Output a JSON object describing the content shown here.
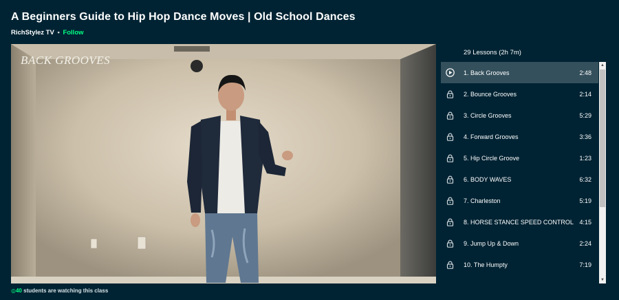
{
  "class": {
    "title": "A Beginners Guide to Hip Hop Dance Moves | Old School Dances",
    "teacher": "RichStylez TV",
    "separator": "•",
    "follow_label": "Follow"
  },
  "video": {
    "caption": "BACK GROOVES"
  },
  "watching": {
    "count": "40",
    "text": "students are watching this class"
  },
  "lessons": {
    "summary": "29 Lessons (2h 7m)",
    "items": [
      {
        "label": "1. Back Grooves",
        "duration": "2:48",
        "status": "playing"
      },
      {
        "label": "2. Bounce Grooves",
        "duration": "2:14",
        "status": "locked"
      },
      {
        "label": "3. Circle Grooves",
        "duration": "5:29",
        "status": "locked"
      },
      {
        "label": "4. Forward Grooves",
        "duration": "3:36",
        "status": "locked"
      },
      {
        "label": "5. Hip Circle Groove",
        "duration": "1:23",
        "status": "locked"
      },
      {
        "label": "6. BODY WAVES",
        "duration": "6:32",
        "status": "locked"
      },
      {
        "label": "7. Charleston",
        "duration": "5:19",
        "status": "locked"
      },
      {
        "label": "8. HORSE STANCE SPEED CONTROL",
        "duration": "4:15",
        "status": "locked"
      },
      {
        "label": "9. Jump Up & Down",
        "duration": "2:24",
        "status": "locked"
      },
      {
        "label": "10. The Humpty",
        "duration": "7:19",
        "status": "locked"
      }
    ]
  },
  "colors": {
    "background": "#002333",
    "accent": "#00ff84",
    "active_row": "#34505c"
  },
  "icons": {
    "playing": "play-circle-icon",
    "locked": "lock-icon"
  }
}
